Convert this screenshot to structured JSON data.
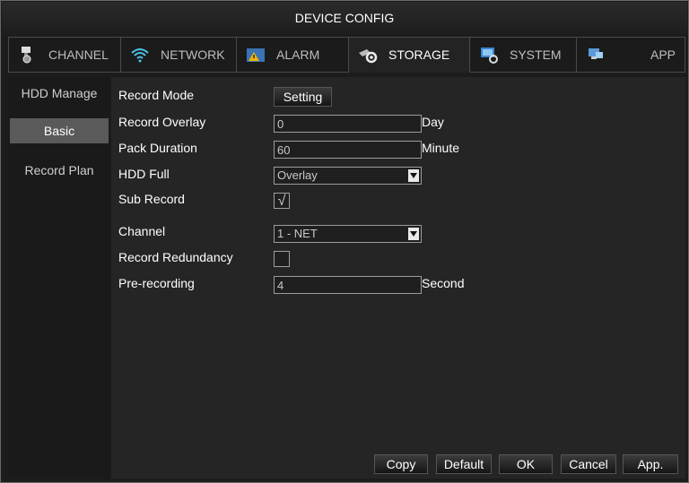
{
  "window": {
    "title": "DEVICE CONFIG"
  },
  "tabs": [
    {
      "label": "CHANNEL",
      "icon": "camera-icon"
    },
    {
      "label": "NETWORK",
      "icon": "wifi-icon"
    },
    {
      "label": "ALARM",
      "icon": "alarm-warning-icon"
    },
    {
      "label": "STORAGE",
      "icon": "storage-gear-icon",
      "active": true
    },
    {
      "label": "SYSTEM",
      "icon": "system-monitor-icon"
    },
    {
      "label": "APP",
      "icon": "app-icon"
    }
  ],
  "sidebar": {
    "items": [
      {
        "label": "HDD Manage"
      },
      {
        "label": "Basic",
        "active": true
      },
      {
        "label": "Record Plan"
      }
    ]
  },
  "form": {
    "record_mode": {
      "label": "Record Mode",
      "button": "Setting"
    },
    "record_overlay": {
      "label": "Record Overlay",
      "value": "0",
      "unit": "Day"
    },
    "pack_duration": {
      "label": "Pack Duration",
      "value": "60",
      "unit": "Minute"
    },
    "hdd_full": {
      "label": "HDD Full",
      "value": "Overlay"
    },
    "sub_record": {
      "label": "Sub Record",
      "checked": true,
      "mark": "√"
    },
    "channel": {
      "label": "Channel",
      "value": "1 - NET"
    },
    "record_redundancy": {
      "label": "Record Redundancy",
      "checked": false
    },
    "pre_recording": {
      "label": "Pre-recording",
      "value": "4",
      "unit": "Second"
    }
  },
  "footer": {
    "copy": "Copy",
    "default": "Default",
    "ok": "OK",
    "cancel": "Cancel",
    "apply": "App."
  },
  "colors": {
    "background": "#1c1c1c",
    "panel": "#252525",
    "active_side": "#5a5a5a",
    "text": "#ffffff"
  }
}
